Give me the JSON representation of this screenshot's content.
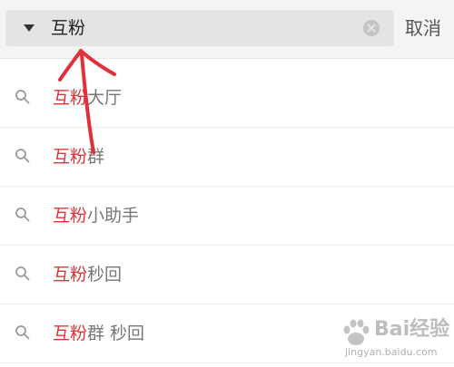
{
  "search": {
    "value": "互粉",
    "cancel_label": "取消"
  },
  "suggestions": [
    {
      "highlight": "互粉",
      "rest": "大厅"
    },
    {
      "highlight": "互粉",
      "rest": "群"
    },
    {
      "highlight": "互粉",
      "rest": "小助手"
    },
    {
      "highlight": "互粉",
      "rest": "秒回"
    },
    {
      "highlight": "互粉",
      "rest": "群 秒回"
    }
  ],
  "watermark": {
    "logo_text": "Bai经验",
    "url": "jingyan.baidu.com"
  },
  "colors": {
    "highlight": "#d9363a",
    "annotation_arrow": "#e0303a"
  },
  "icons": {
    "dropdown": "triangle-down-icon",
    "clear": "clear-icon",
    "suggestion": "search-icon"
  }
}
